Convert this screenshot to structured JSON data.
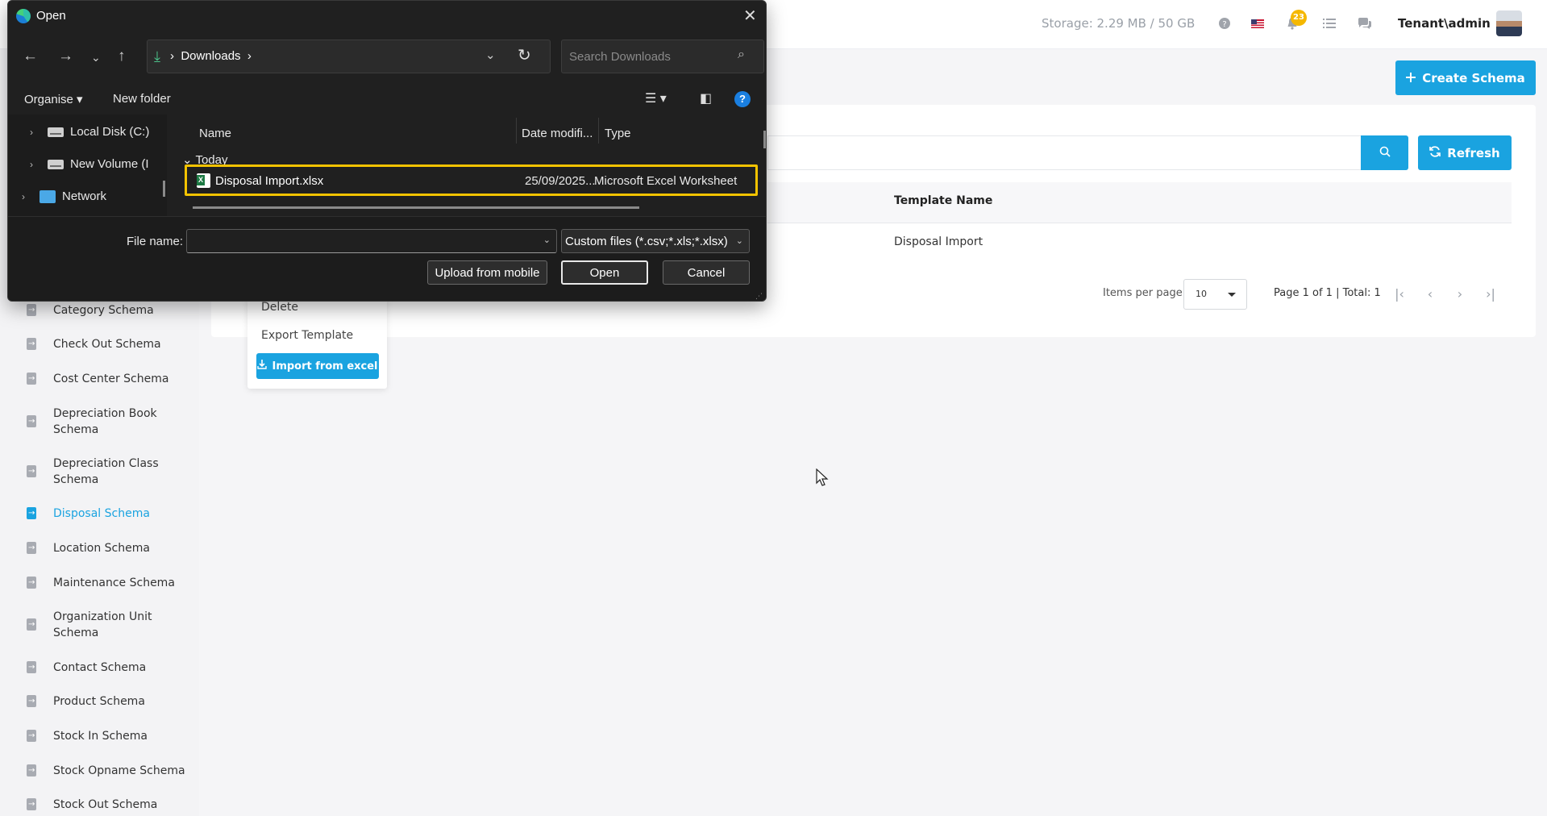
{
  "header": {
    "storage": "Storage: 2.29 MB / 50 GB",
    "notification_count": "23",
    "user": "Tenant\\admin"
  },
  "sidebar": {
    "items": [
      {
        "label": "Category Schema",
        "active": false
      },
      {
        "label": "Check Out Schema",
        "active": false
      },
      {
        "label": "Cost Center Schema",
        "active": false
      },
      {
        "label": "Depreciation Book Schema",
        "active": false
      },
      {
        "label": "Depreciation Class Schema",
        "active": false
      },
      {
        "label": "Disposal Schema",
        "active": true
      },
      {
        "label": "Location Schema",
        "active": false
      },
      {
        "label": "Maintenance Schema",
        "active": false
      },
      {
        "label": "Organization Unit Schema",
        "active": false
      },
      {
        "label": "Contact Schema",
        "active": false
      },
      {
        "label": "Product Schema",
        "active": false
      },
      {
        "label": "Stock In Schema",
        "active": false
      },
      {
        "label": "Stock Opname Schema",
        "active": false
      },
      {
        "label": "Stock Out Schema",
        "active": false
      }
    ]
  },
  "main": {
    "create_label": "Create Schema",
    "refresh_label": "Refresh",
    "table": {
      "column": "Template Name",
      "rows": [
        "Disposal Import"
      ]
    },
    "pagination": {
      "items_per_page_label": "Items per page",
      "items_per_page_value": "10",
      "page_info": "Page 1 of 1 | Total: 1"
    },
    "action_menu": {
      "delete": "Delete",
      "export": "Export Template",
      "import": "Import from excel"
    }
  },
  "dialog": {
    "title": "Open",
    "address": "Downloads",
    "search_placeholder": "Search Downloads",
    "toolbar": {
      "organise": "Organise",
      "new_folder": "New folder"
    },
    "nav_pane": [
      "Local Disk (C:)",
      "New Volume (I",
      "Network"
    ],
    "columns": {
      "name": "Name",
      "date": "Date modifi...",
      "type": "Type"
    },
    "group": "Today",
    "files": [
      {
        "name": "Disposal Import.xlsx",
        "date": "25/09/2025...",
        "type": "Microsoft Excel Worksheet",
        "icon": "excel-file-icon"
      }
    ],
    "file_name_label": "File name:",
    "file_name_value": "",
    "filter": "Custom files (*.csv;*.xls;*.xlsx)",
    "buttons": {
      "upload": "Upload from mobile",
      "open": "Open",
      "cancel": "Cancel"
    },
    "highlight_color": "#f3c300"
  },
  "colors": {
    "accent": "#1aa3e0",
    "badge": "#f5b800",
    "dialog_bg": "#202020"
  }
}
